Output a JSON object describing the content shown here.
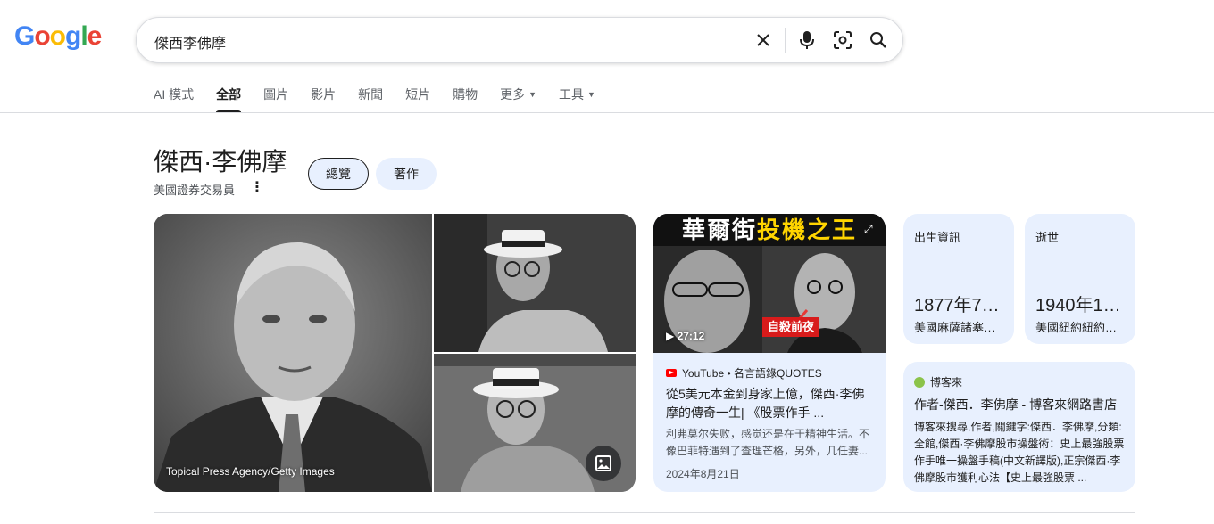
{
  "logo": {
    "letters": [
      "G",
      "o",
      "o",
      "g",
      "l",
      "e"
    ],
    "colors": [
      "#4285f4",
      "#ea4335",
      "#fbbc05",
      "#4285f4",
      "#34a853",
      "#ea4335"
    ]
  },
  "search": {
    "query": "傑西李佛摩",
    "icons": [
      "clear-icon",
      "mic-icon",
      "lens-icon",
      "search-icon"
    ]
  },
  "tabs": [
    {
      "label": "AI 模式",
      "active": false
    },
    {
      "label": "全部",
      "active": true
    },
    {
      "label": "圖片",
      "active": false
    },
    {
      "label": "影片",
      "active": false
    },
    {
      "label": "新聞",
      "active": false
    },
    {
      "label": "短片",
      "active": false
    },
    {
      "label": "購物",
      "active": false
    },
    {
      "label": "更多",
      "active": false
    },
    {
      "label": "工具",
      "active": false
    }
  ],
  "entity": {
    "title": "傑西·李佛摩",
    "subtitle": "美國證券交易員",
    "more": "⋮",
    "chips": [
      "總覽",
      "著作"
    ]
  },
  "images": {
    "credit": "Topical Press Agency/Getty Images"
  },
  "video": {
    "banner_white": "華爾街",
    "banner_yellow": "投機之王",
    "stamp": "自殺前夜",
    "duration": "▶ 27:12",
    "source": "YouTube • 名言語錄QUOTES",
    "title": "從5美元本金到身家上億，傑西·李佛摩的傳奇一生| 《股票作手 ...",
    "snippet": "利弗莫尔失败，感觉还是在于精神生活。不像巴菲特遇到了查理芒格，另外，几任妻...",
    "date": "2024年8月21日"
  },
  "facts": [
    {
      "label": "出生資訊",
      "value": "1877年7…",
      "place": "美國麻薩諸塞…"
    },
    {
      "label": "逝世",
      "value": "1940年1…",
      "place": "美國紐約紐約…"
    }
  ],
  "web_result": {
    "source": "博客來",
    "title": "作者-傑西．李佛摩 - 博客來網路書店",
    "snippet": "博客來搜尋,作者,關鍵字:傑西．李佛摩,分類:全館,傑西·李佛摩股市操盤術：史上最強股票作手唯一操盤手稿(中文新譯版),正宗傑西·李佛摩股市獲利心法【史上最強股票 ..."
  }
}
